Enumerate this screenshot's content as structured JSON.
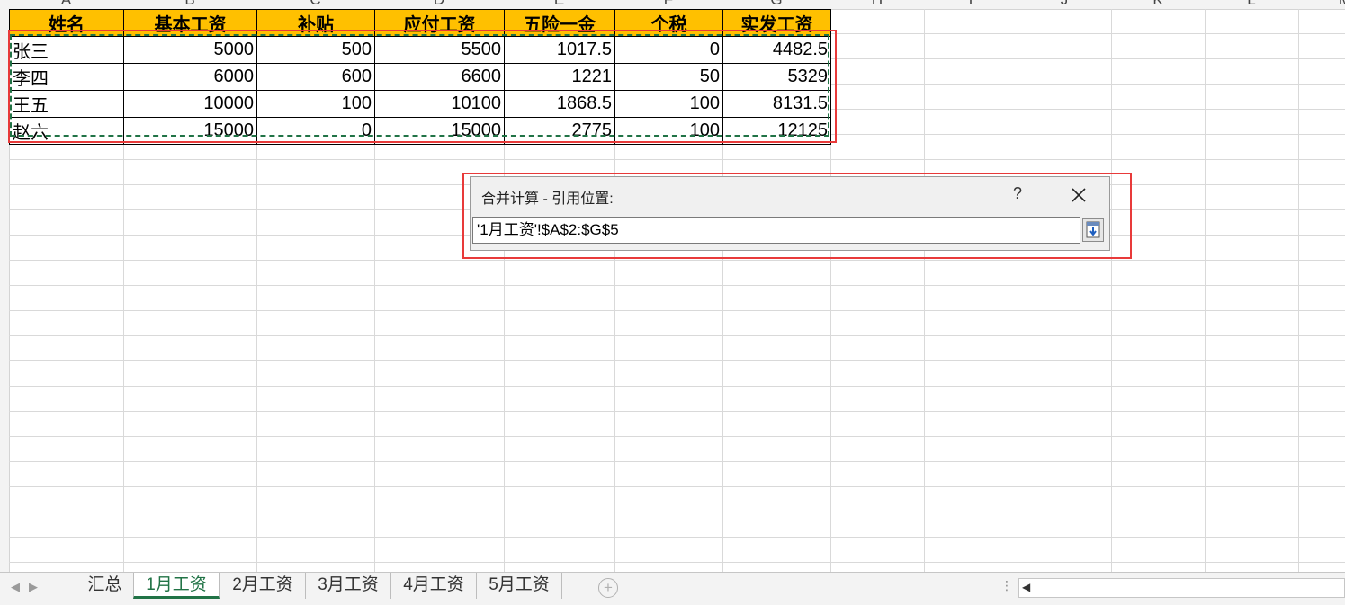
{
  "column_letters": [
    "A",
    "B",
    "C",
    "D",
    "E",
    "F",
    "G",
    "H",
    "I",
    "J",
    "K",
    "L",
    "M"
  ],
  "table": {
    "headers": [
      "姓名",
      "基本工资",
      "补贴",
      "应付工资",
      "五险一金",
      "个税",
      "实发工资"
    ],
    "rows": [
      [
        "张三",
        "5000",
        "500",
        "5500",
        "1017.5",
        "0",
        "4482.5"
      ],
      [
        "李四",
        "6000",
        "600",
        "6600",
        "1221",
        "50",
        "5329"
      ],
      [
        "王五",
        "10000",
        "100",
        "10100",
        "1868.5",
        "100",
        "8131.5"
      ],
      [
        "赵六",
        "15000",
        "0",
        "15000",
        "2775",
        "100",
        "12125"
      ]
    ]
  },
  "dialog": {
    "title": "合并计算 - 引用位置:",
    "help": "?",
    "reference_value": "'1月工资'!$A$2:$G$5"
  },
  "sheet_tabs": [
    {
      "label": "汇总",
      "active": false
    },
    {
      "label": "1月工资",
      "active": true
    },
    {
      "label": "2月工资",
      "active": false
    },
    {
      "label": "3月工资",
      "active": false
    },
    {
      "label": "4月工资",
      "active": false
    },
    {
      "label": "5月工资",
      "active": false
    }
  ],
  "add_sheet": "+",
  "colors": {
    "header_fill": "#ffc000",
    "highlight_border": "#e83a3a",
    "excel_green": "#217346"
  }
}
